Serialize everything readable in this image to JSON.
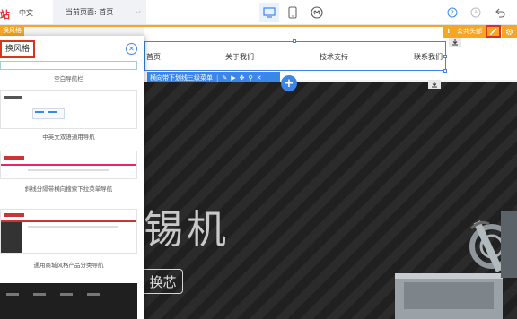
{
  "topbar": {
    "logo": "站",
    "lang": "中文",
    "current_page": "当前页面: 首页"
  },
  "tags": {
    "replace_style": "换风格",
    "public_header": "公共头部"
  },
  "nav": {
    "items": [
      "首页",
      "关于我们",
      "技术支持",
      "联系我们"
    ]
  },
  "nav_toolbar": {
    "label": "横向带下划线三级菜单"
  },
  "banner": {
    "title": "锡机",
    "button": "换芯"
  },
  "panel": {
    "title": "换风格",
    "templates": [
      "空白导航栏",
      "中英文双语通用导航",
      "斜线分隔带横向搜索下拉菜单导航",
      "通用商城风格产品分类导航"
    ]
  },
  "colors": {
    "accent": "#f6a623",
    "primary": "#3b86e8",
    "highlight": "#d9321f",
    "banner": "#222222"
  }
}
